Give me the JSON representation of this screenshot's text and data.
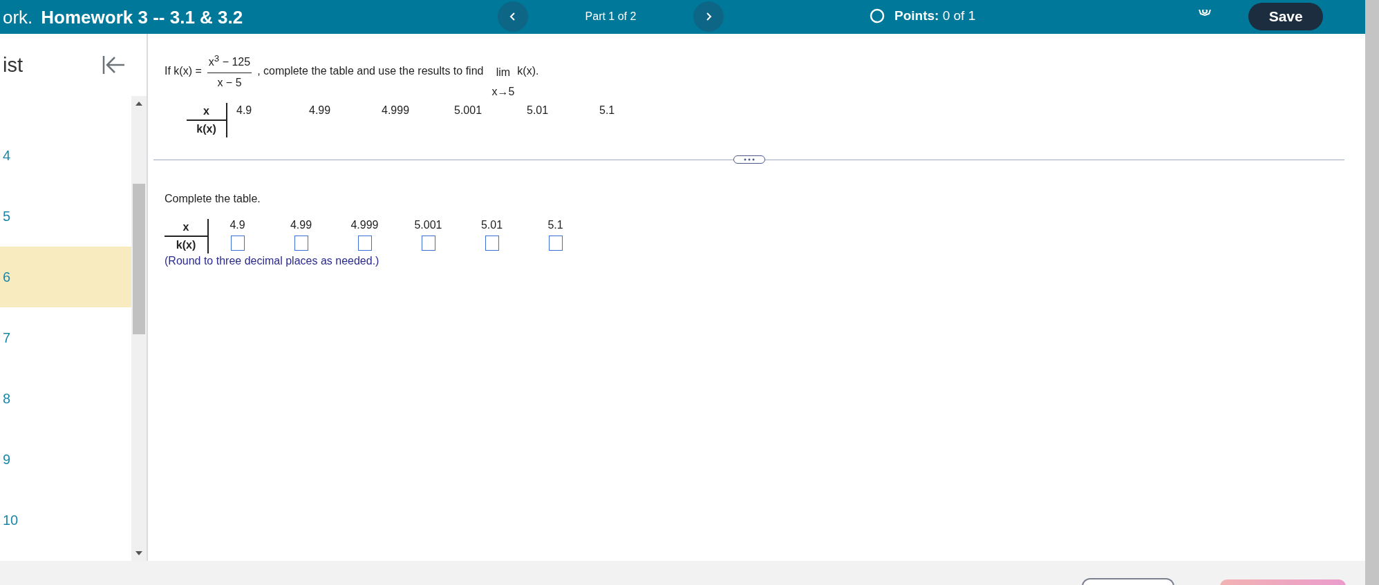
{
  "header": {
    "title_prefix": "ork.",
    "title": "Homework 3 -- 3.1 & 3.2",
    "part": "Part 1 of 2",
    "points_label": "Points:",
    "points_value": "0 of 1",
    "save": "Save"
  },
  "sidebar": {
    "heading": "ist",
    "items": [
      {
        "label": "4",
        "selected": false
      },
      {
        "label": "5",
        "selected": false
      },
      {
        "label": "6",
        "selected": true
      },
      {
        "label": "7",
        "selected": false
      },
      {
        "label": "8",
        "selected": false
      },
      {
        "label": "9",
        "selected": false
      },
      {
        "label": "10",
        "selected": false
      }
    ]
  },
  "question": {
    "lead": "If k(x) =",
    "numerator": "x$^{3}$ − 125",
    "denominator": "x − 5",
    "tail": ", complete the table and use the results to find",
    "limit": "lim",
    "limit_sub": "x→5",
    "limit_expr": "k(x).",
    "table": {
      "row_headers": [
        "x",
        "k(x)"
      ],
      "x_values": [
        "4.9",
        "4.99",
        "4.999",
        "5.001",
        "5.01",
        "5.1"
      ]
    }
  },
  "answer": {
    "instruction": "Complete the table.",
    "table": {
      "row_headers": [
        "x",
        "k(x)"
      ],
      "x_values": [
        "4.9",
        "4.99",
        "4.999",
        "5.001",
        "5.01",
        "5.1"
      ]
    },
    "note": "(Round to three decimal places as needed.)"
  }
}
